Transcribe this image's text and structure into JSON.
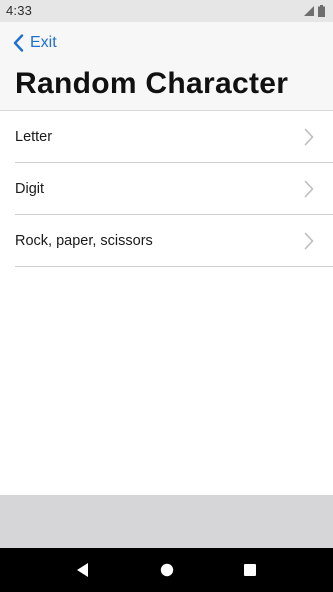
{
  "status_bar": {
    "time": "4:33",
    "icons": [
      "signal-icon",
      "battery-icon"
    ]
  },
  "nav": {
    "back_label": "Exit",
    "back_icon": "chevron-left-icon",
    "title": "Random Character",
    "accent_color": "#1f6fd0"
  },
  "list": {
    "items": [
      {
        "label": "Letter",
        "icon": "chevron-right-icon"
      },
      {
        "label": "Digit",
        "icon": "chevron-right-icon"
      },
      {
        "label": "Rock, paper, scissors",
        "icon": "chevron-right-icon"
      }
    ]
  },
  "system_nav": {
    "buttons": [
      "back-triangle-icon",
      "home-circle-icon",
      "recents-square-icon"
    ]
  }
}
